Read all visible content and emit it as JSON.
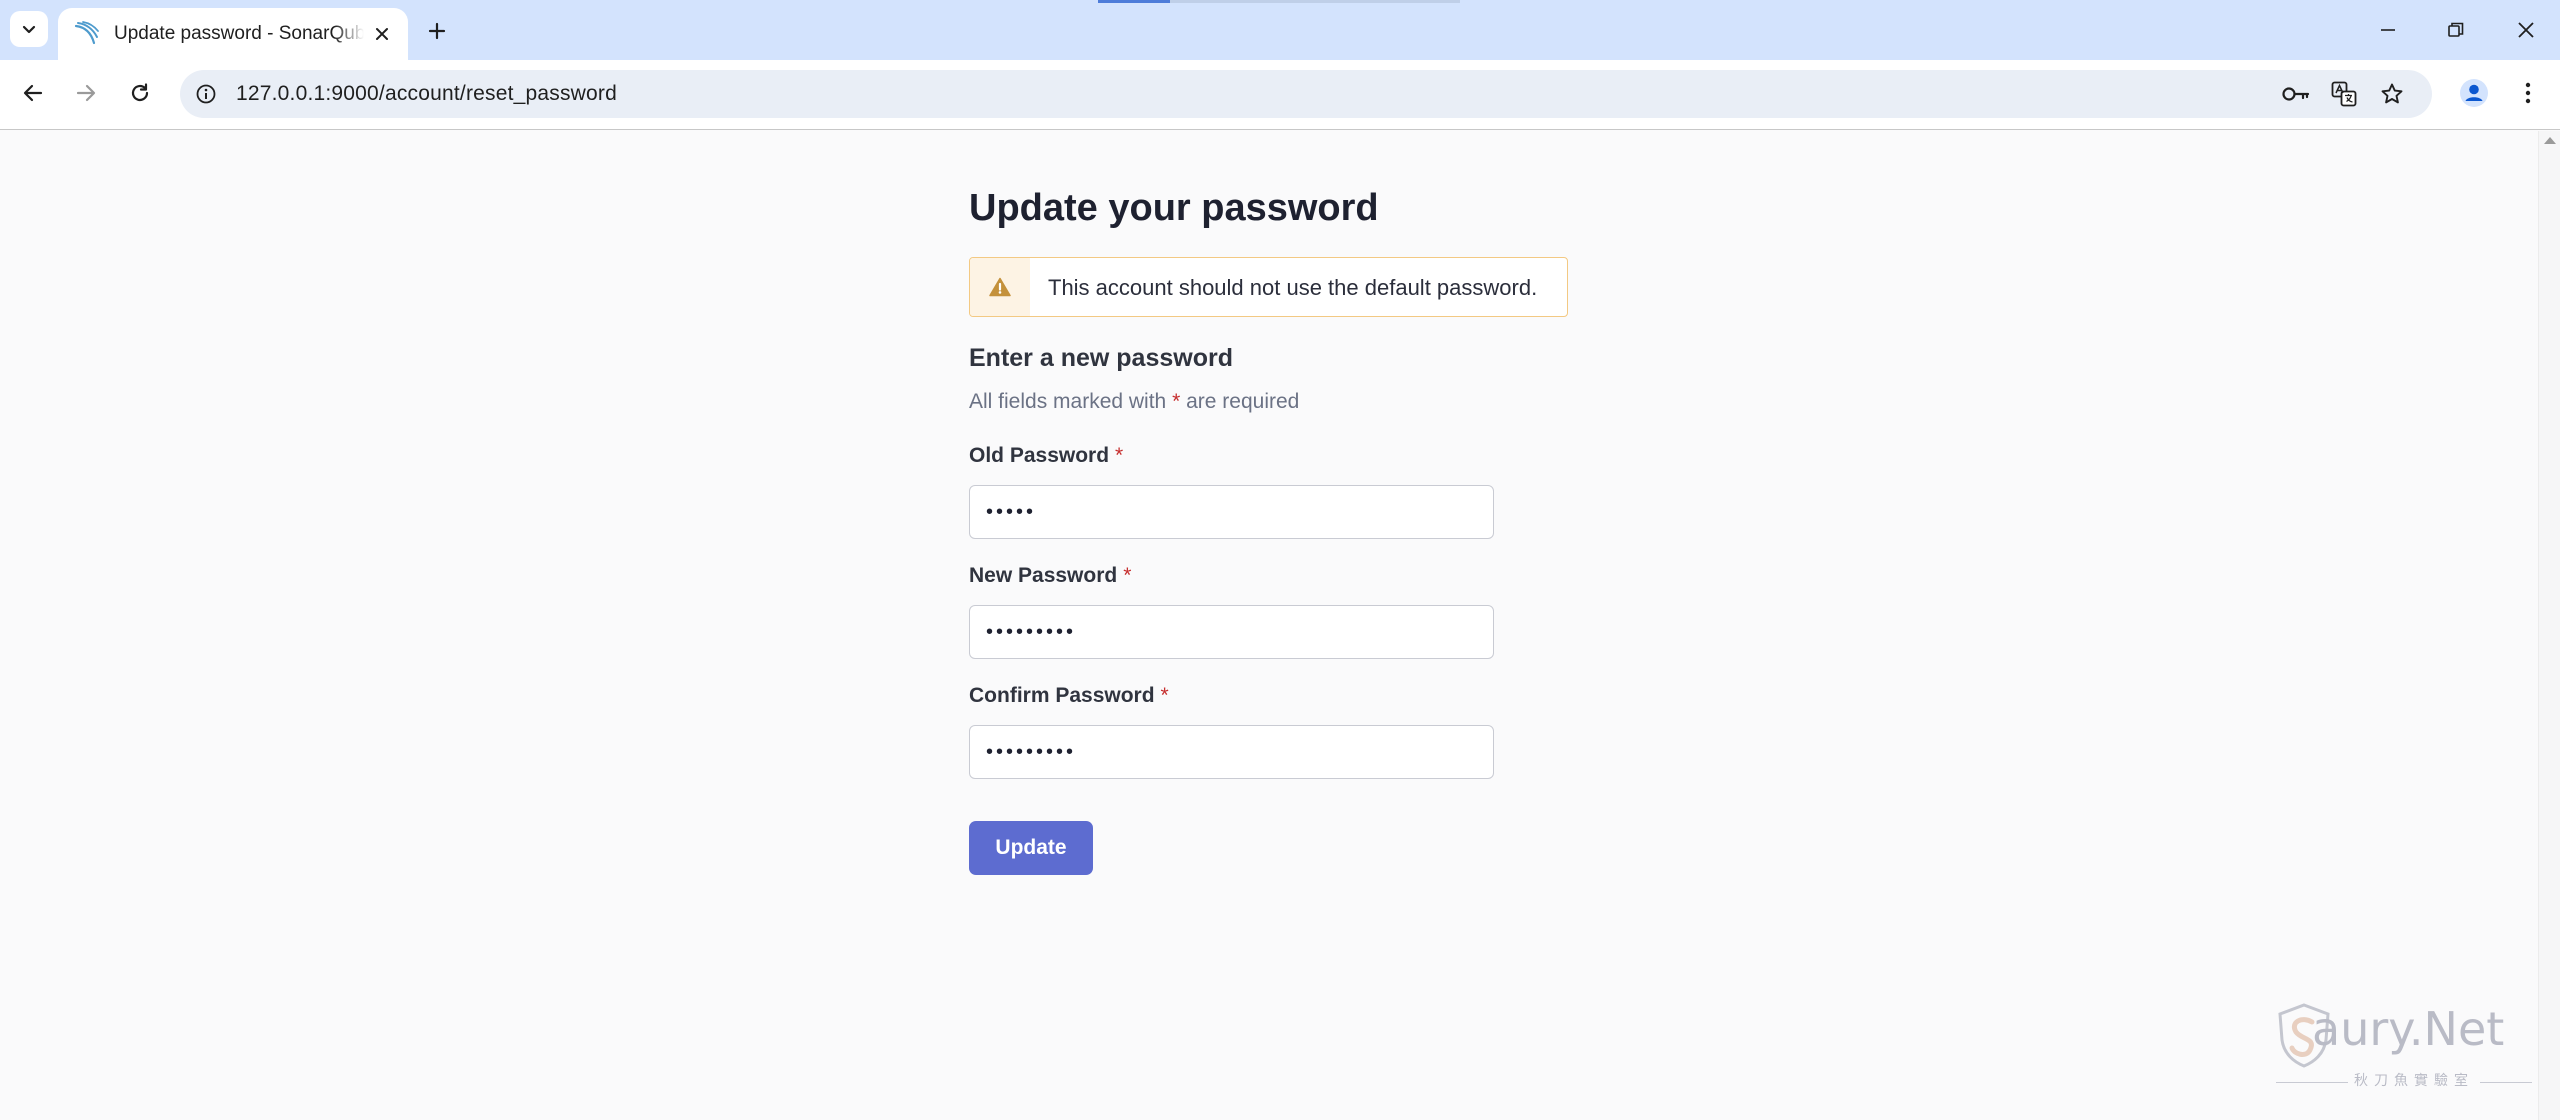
{
  "browser": {
    "tab_title": "Update password - SonarQube",
    "url": "127.0.0.1:9000/account/reset_password"
  },
  "page": {
    "title": "Update your password",
    "alert": "This account should not use the default password.",
    "section_title": "Enter a new password",
    "required_note_before": "All fields marked with ",
    "required_star": "*",
    "required_note_after": " are required",
    "fields": [
      {
        "label": "Old Password",
        "value": "•••••"
      },
      {
        "label": "New Password",
        "value": "•••••••••"
      },
      {
        "label": "Confirm Password",
        "value": "•••••••••"
      }
    ],
    "submit_label": "Update"
  },
  "watermark": {
    "text": "aury.Net",
    "sub": "秋刀魚實驗室"
  },
  "colors": {
    "primary_button": "#5d6cd0",
    "warning_border": "#f3c983",
    "warning_icon": "#c4913b",
    "required_star": "#c62e2e"
  }
}
